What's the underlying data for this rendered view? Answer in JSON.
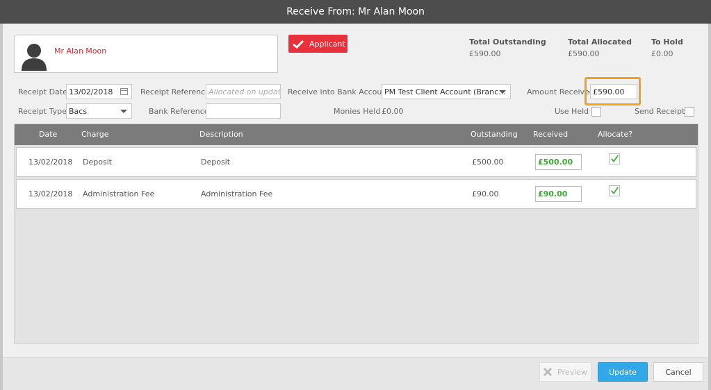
{
  "window": {
    "title": "Receive From: Mr Alan Moon"
  },
  "applicant": {
    "name": "Mr Alan Moon",
    "badge_label": "Applicant"
  },
  "totals": {
    "outstanding_label": "Total Outstanding",
    "outstanding_value": "£590.00",
    "allocated_label": "Total Allocated",
    "allocated_value": "£590.00",
    "hold_label": "To Hold",
    "hold_value": "£0.00"
  },
  "form": {
    "receipt_date_label": "Receipt Date",
    "receipt_date_value": "13/02/2018",
    "receipt_reference_label": "Receipt Reference",
    "receipt_reference_placeholder": "Allocated on update",
    "bank_account_label": "Receive into Bank Account",
    "bank_account_value": "PM Test Client Account (Branc...",
    "amount_received_label": "Amount Received",
    "amount_received_value": "£590.00",
    "receipt_type_label": "Receipt Type",
    "receipt_type_value": "Bacs",
    "bank_reference_label": "Bank Reference",
    "bank_reference_value": "",
    "monies_held_label": "Monies Held",
    "monies_held_value": "£0.00",
    "use_held_label": "Use Held",
    "send_receipt_label": "Send Receipt"
  },
  "table": {
    "headers": [
      "Date",
      "Charge",
      "Description",
      "Outstanding",
      "Received",
      "Allocate?"
    ],
    "rows": [
      {
        "date": "13/02/2018",
        "charge": "Deposit",
        "description": "Deposit",
        "outstanding": "£500.00",
        "received": "£500.00",
        "allocate": true
      },
      {
        "date": "13/02/2018",
        "charge": "Administration Fee",
        "description": "Administration Fee",
        "outstanding": "£90.00",
        "received": "£90.00",
        "allocate": true
      }
    ]
  },
  "footer": {
    "preview_label": "Preview",
    "update_label": "Update",
    "cancel_label": "Cancel"
  },
  "colors": {
    "accent": "#32a8e8",
    "badge": "#e8313a",
    "name": "#d9282f",
    "received": "#3aaa35",
    "highlight": "#f0a020"
  },
  "icons": [
    "user-silhouette-icon",
    "check-icon",
    "calendar-icon",
    "chevron-down-icon",
    "close-icon"
  ]
}
